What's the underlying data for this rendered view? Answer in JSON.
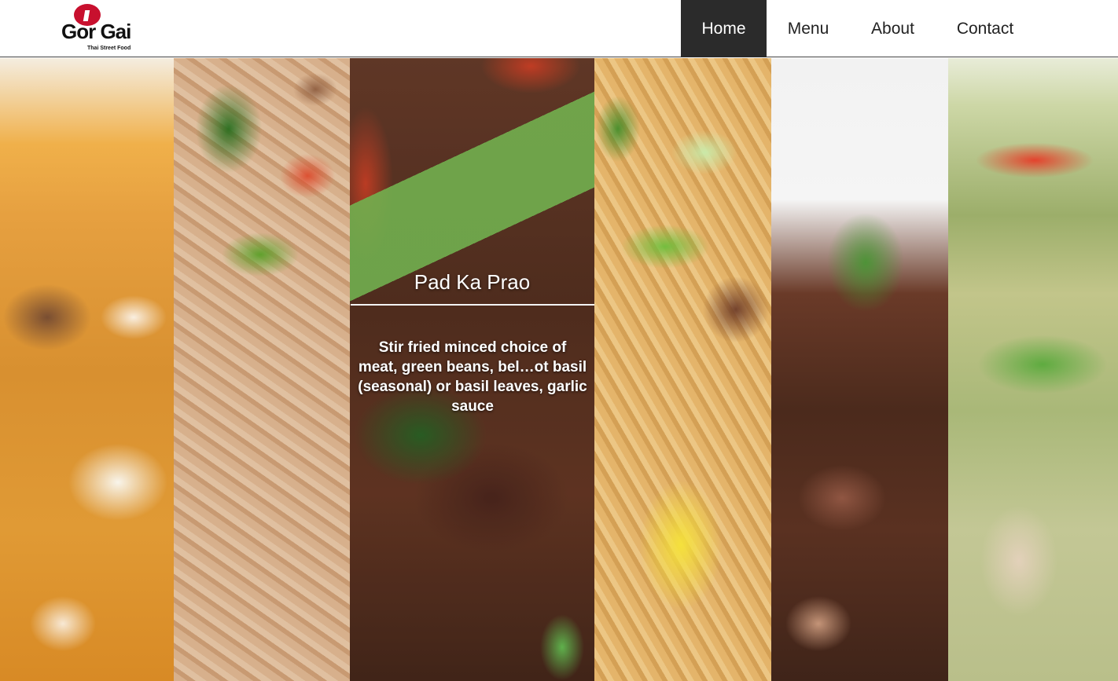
{
  "brand": {
    "name": "Gor Gai",
    "tagline": "Thai Street Food",
    "accent_color": "#c8102e"
  },
  "nav": {
    "items": [
      {
        "label": "Home",
        "active": true
      },
      {
        "label": "Menu",
        "active": false
      },
      {
        "label": "About",
        "active": false
      },
      {
        "label": "Contact",
        "active": false
      }
    ]
  },
  "featured": {
    "name": "Pad Ka Prao",
    "description": "Stir fried minced choice of meat, green beans, bel…ot basil (seasonal) or basil leaves, garlic sauce"
  },
  "gallery": {
    "panels": [
      "curry-photo",
      "fried-rice-photo",
      "pad-ka-prao-photo",
      "pineapple-fried-rice-photo",
      "glazed-meat-photo",
      "green-curry-photo"
    ]
  }
}
